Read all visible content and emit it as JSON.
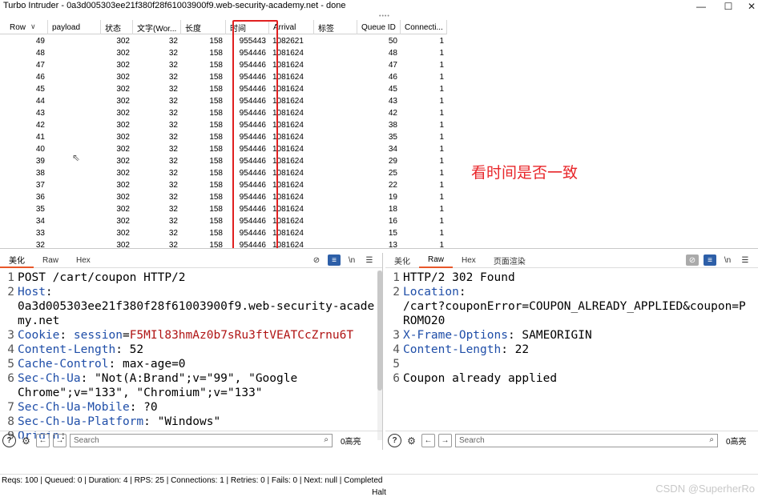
{
  "window": {
    "title": "Turbo Intruder - 0a3d005303ee21f380f28f61003900f9.web-security-academy.net - done",
    "minimize": "—",
    "maximize": "☐",
    "close": "✕"
  },
  "table": {
    "columns": [
      "Row",
      "payload",
      "状态",
      "文字(Wor...",
      "长度",
      "时间",
      "Arrival",
      "标签",
      "Queue ID",
      "Connecti..."
    ],
    "sort_indicator": "∨",
    "rows": [
      {
        "row": "49",
        "payload": "",
        "status": "302",
        "words": "32",
        "length": "158",
        "time": "955443",
        "arrival": "1082621",
        "tag": "",
        "queue": "50",
        "conn": "1"
      },
      {
        "row": "48",
        "payload": "",
        "status": "302",
        "words": "32",
        "length": "158",
        "time": "954446",
        "arrival": "1081624",
        "tag": "",
        "queue": "48",
        "conn": "1"
      },
      {
        "row": "47",
        "payload": "",
        "status": "302",
        "words": "32",
        "length": "158",
        "time": "954446",
        "arrival": "1081624",
        "tag": "",
        "queue": "47",
        "conn": "1"
      },
      {
        "row": "46",
        "payload": "",
        "status": "302",
        "words": "32",
        "length": "158",
        "time": "954446",
        "arrival": "1081624",
        "tag": "",
        "queue": "46",
        "conn": "1"
      },
      {
        "row": "45",
        "payload": "",
        "status": "302",
        "words": "32",
        "length": "158",
        "time": "954446",
        "arrival": "1081624",
        "tag": "",
        "queue": "45",
        "conn": "1"
      },
      {
        "row": "44",
        "payload": "",
        "status": "302",
        "words": "32",
        "length": "158",
        "time": "954446",
        "arrival": "1081624",
        "tag": "",
        "queue": "43",
        "conn": "1"
      },
      {
        "row": "43",
        "payload": "",
        "status": "302",
        "words": "32",
        "length": "158",
        "time": "954446",
        "arrival": "1081624",
        "tag": "",
        "queue": "42",
        "conn": "1"
      },
      {
        "row": "42",
        "payload": "",
        "status": "302",
        "words": "32",
        "length": "158",
        "time": "954446",
        "arrival": "1081624",
        "tag": "",
        "queue": "38",
        "conn": "1"
      },
      {
        "row": "41",
        "payload": "",
        "status": "302",
        "words": "32",
        "length": "158",
        "time": "954446",
        "arrival": "1081624",
        "tag": "",
        "queue": "35",
        "conn": "1"
      },
      {
        "row": "40",
        "payload": "",
        "status": "302",
        "words": "32",
        "length": "158",
        "time": "954446",
        "arrival": "1081624",
        "tag": "",
        "queue": "34",
        "conn": "1"
      },
      {
        "row": "39",
        "payload": "",
        "status": "302",
        "words": "32",
        "length": "158",
        "time": "954446",
        "arrival": "1081624",
        "tag": "",
        "queue": "29",
        "conn": "1"
      },
      {
        "row": "38",
        "payload": "",
        "status": "302",
        "words": "32",
        "length": "158",
        "time": "954446",
        "arrival": "1081624",
        "tag": "",
        "queue": "25",
        "conn": "1"
      },
      {
        "row": "37",
        "payload": "",
        "status": "302",
        "words": "32",
        "length": "158",
        "time": "954446",
        "arrival": "1081624",
        "tag": "",
        "queue": "22",
        "conn": "1"
      },
      {
        "row": "36",
        "payload": "",
        "status": "302",
        "words": "32",
        "length": "158",
        "time": "954446",
        "arrival": "1081624",
        "tag": "",
        "queue": "19",
        "conn": "1"
      },
      {
        "row": "35",
        "payload": "",
        "status": "302",
        "words": "32",
        "length": "158",
        "time": "954446",
        "arrival": "1081624",
        "tag": "",
        "queue": "18",
        "conn": "1"
      },
      {
        "row": "34",
        "payload": "",
        "status": "302",
        "words": "32",
        "length": "158",
        "time": "954446",
        "arrival": "1081624",
        "tag": "",
        "queue": "16",
        "conn": "1"
      },
      {
        "row": "33",
        "payload": "",
        "status": "302",
        "words": "32",
        "length": "158",
        "time": "954446",
        "arrival": "1081624",
        "tag": "",
        "queue": "15",
        "conn": "1"
      },
      {
        "row": "32",
        "payload": "",
        "status": "302",
        "words": "32",
        "length": "158",
        "time": "954446",
        "arrival": "1081624",
        "tag": "",
        "queue": "13",
        "conn": "1"
      }
    ]
  },
  "annotation": "看时间是否一致",
  "request_panel": {
    "tabs": [
      "美化",
      "Raw",
      "Hex"
    ],
    "active_tab": "美化",
    "lines": [
      {
        "n": "1",
        "parts": [
          {
            "t": "POST /cart/coupon HTTP/2",
            "c": "plain"
          }
        ]
      },
      {
        "n": "2",
        "parts": [
          {
            "t": "Host",
            "c": "hname"
          },
          {
            "t": ":\n0a3d005303ee21f380f28f61003900f9.web-security-academy.net",
            "c": "plain"
          }
        ]
      },
      {
        "n": "3",
        "parts": [
          {
            "t": "Cookie",
            "c": "hname"
          },
          {
            "t": ": ",
            "c": "plain"
          },
          {
            "t": "session",
            "c": "hname"
          },
          {
            "t": "=",
            "c": "plain"
          },
          {
            "t": "F5MIl83hmAz0b7sRu3ftVEATCcZrnu6T",
            "c": "cookie"
          }
        ]
      },
      {
        "n": "4",
        "parts": [
          {
            "t": "Content-Length",
            "c": "hname"
          },
          {
            "t": ": 52",
            "c": "plain"
          }
        ]
      },
      {
        "n": "5",
        "parts": [
          {
            "t": "Cache-Control",
            "c": "hname"
          },
          {
            "t": ": max-age=0",
            "c": "plain"
          }
        ]
      },
      {
        "n": "6",
        "parts": [
          {
            "t": "Sec-Ch-Ua",
            "c": "hname"
          },
          {
            "t": ": \"Not(A:Brand\";v=\"99\", \"Google\nChrome\";v=\"133\", \"Chromium\";v=\"133\"",
            "c": "plain"
          }
        ]
      },
      {
        "n": "7",
        "parts": [
          {
            "t": "Sec-Ch-Ua-Mobile",
            "c": "hname"
          },
          {
            "t": ": ?0",
            "c": "plain"
          }
        ]
      },
      {
        "n": "8",
        "parts": [
          {
            "t": "Sec-Ch-Ua-Platform",
            "c": "hname"
          },
          {
            "t": ": \"Windows\"",
            "c": "plain"
          }
        ]
      },
      {
        "n": "9",
        "parts": [
          {
            "t": "Origin",
            "c": "hname"
          },
          {
            "t": ":",
            "c": "plain"
          }
        ]
      }
    ],
    "search_placeholder": "Search",
    "matches": "0高亮"
  },
  "response_panel": {
    "tabs": [
      "美化",
      "Raw",
      "Hex",
      "页面渲染"
    ],
    "active_tab": "Raw",
    "lines": [
      {
        "n": "1",
        "parts": [
          {
            "t": "HTTP/2 302 Found",
            "c": "plain"
          }
        ]
      },
      {
        "n": "2",
        "parts": [
          {
            "t": "Location",
            "c": "hname"
          },
          {
            "t": ":\n/cart?couponError=COUPON_ALREADY_APPLIED&coupon=P\nROMO20",
            "c": "plain"
          }
        ]
      },
      {
        "n": "3",
        "parts": [
          {
            "t": "X-Frame-Options",
            "c": "hname"
          },
          {
            "t": ": SAMEORIGIN",
            "c": "plain"
          }
        ]
      },
      {
        "n": "4",
        "parts": [
          {
            "t": "Content-Length",
            "c": "hname"
          },
          {
            "t": ": 22",
            "c": "plain"
          }
        ]
      },
      {
        "n": "5",
        "parts": [
          {
            "t": "",
            "c": "plain"
          }
        ]
      },
      {
        "n": "6",
        "parts": [
          {
            "t": "Coupon already applied",
            "c": "plain"
          }
        ]
      }
    ],
    "search_placeholder": "Search",
    "matches": "0高亮"
  },
  "toolbar_icons": {
    "eye_off": "⊘",
    "wrap": "≡",
    "newline": "\\n",
    "menu": "☰"
  },
  "search_icons": {
    "help": "?",
    "settings": "⚙",
    "back": "←",
    "forward": "→",
    "magnifier": "⌕"
  },
  "status": {
    "text": "Reqs: 100 | Queued: 0 | Duration: 4 | RPS: 25 | Connections: 1 | Retries: 0 | Fails: 0 | Next: null | Completed",
    "halt": "Halt"
  },
  "watermark": "CSDN @SuperherRo",
  "colors": {
    "highlight": "#e02020",
    "annotation": "#e8262a",
    "header_name": "#1f4ea8",
    "cookie_value": "#b01414",
    "active_tab_underline": "#e8572a",
    "toggle_blue": "#2d5fa8"
  }
}
